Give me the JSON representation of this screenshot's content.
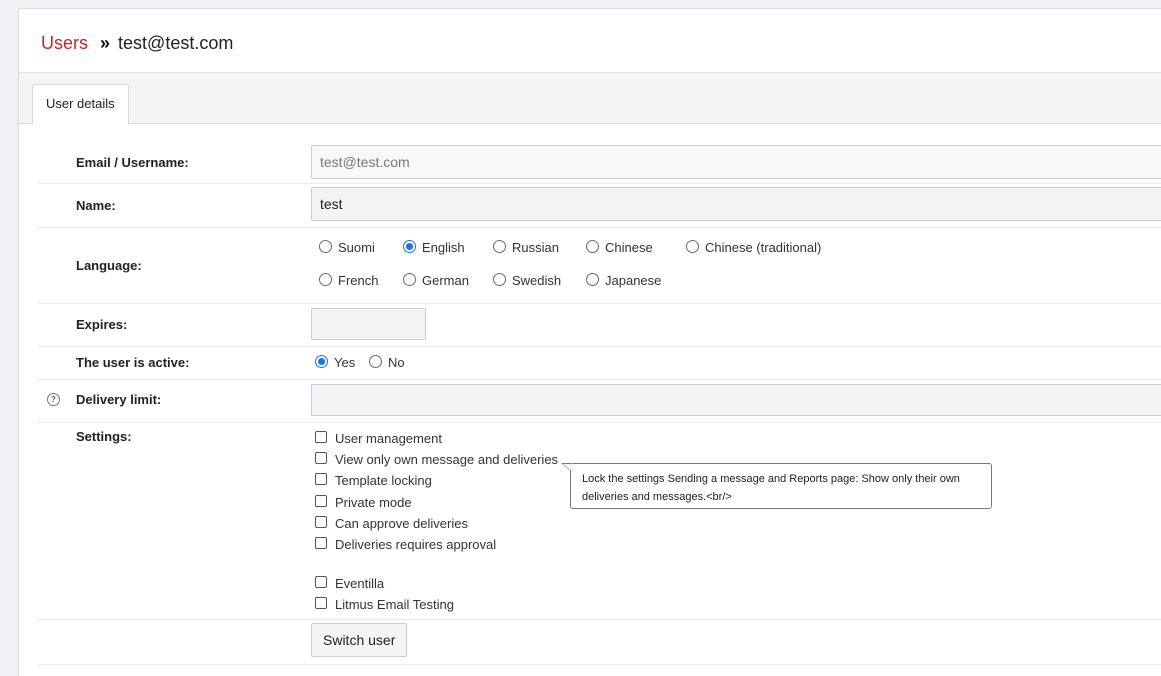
{
  "breadcrumb": {
    "parent": "Users",
    "separator": "»",
    "current": "test@test.com"
  },
  "tabs": [
    {
      "label": "User details",
      "active": true
    }
  ],
  "form": {
    "email": {
      "label": "Email / Username:",
      "value": "test@test.com"
    },
    "name": {
      "label": "Name:",
      "value": "test"
    },
    "language": {
      "label": "Language:",
      "selected": "English",
      "options": [
        "Suomi",
        "English",
        "Russian",
        "Chinese",
        "Chinese (traditional)",
        "French",
        "German",
        "Swedish",
        "Japanese"
      ]
    },
    "expires": {
      "label": "Expires:",
      "value": ""
    },
    "active": {
      "label": "The user is active:",
      "options": [
        "Yes",
        "No"
      ],
      "selected": "Yes"
    },
    "delivery_limit": {
      "label": "Delivery limit:",
      "value": "",
      "help_icon": "question-circle-icon"
    },
    "settings": {
      "label": "Settings:",
      "items": [
        {
          "label": "User management",
          "checked": false
        },
        {
          "label": "View only own message and deliveries",
          "checked": false
        },
        {
          "label": "Template locking",
          "checked": false
        },
        {
          "label": "Private mode",
          "checked": false
        },
        {
          "label": "Can approve deliveries",
          "checked": false
        },
        {
          "label": "Deliveries requires approval",
          "checked": false
        },
        {
          "label": "Eventilla",
          "checked": false
        },
        {
          "label": "Litmus Email Testing",
          "checked": false
        }
      ],
      "tooltip": "Lock the settings Sending a message and Reports page: Show only their own deliveries and messages.<br/>"
    },
    "switch_user_label": "Switch user"
  },
  "colors": {
    "link": "#c0262d",
    "radio_accent": "#1a73e8",
    "page_bg": "#eef0f3"
  }
}
